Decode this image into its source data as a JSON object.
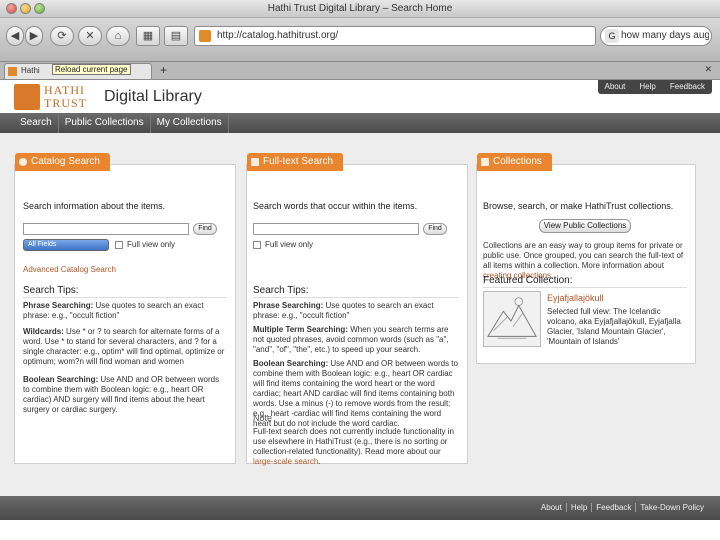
{
  "window": {
    "title": "Hathi Trust Digital Library – Search Home"
  },
  "toolbar": {
    "back": "◀",
    "forward": "▶",
    "reload": "⟳",
    "stop": "✕",
    "home": "⌂",
    "url": "http://catalog.hathitrust.org/",
    "search_value": "how many days august"
  },
  "tabs": {
    "tab_label": "Hathi Trust Digital Library – Search Home",
    "tab_prefix": "Hathi",
    "tooltip": "Reload current page",
    "new_tab": "+",
    "menu": "✕"
  },
  "site": {
    "logo_line1": "HATHI",
    "logo_line2": "TRUST",
    "brand": "Digital Library",
    "util": [
      "About",
      "Help",
      "Feedback"
    ],
    "nav": [
      "Search",
      "Public Collections",
      "My Collections"
    ]
  },
  "catalog": {
    "title": "Catalog Search",
    "intro": "Search information about the items.",
    "find": "Find",
    "field": "All Fields",
    "fullview": "Full view only",
    "advanced": "Advanced Catalog Search",
    "tips_title": "Search Tips:",
    "tips": [
      {
        "label": "Phrase Searching:",
        "text": " Use quotes to search an exact phrase: e.g., \"occult fiction\""
      },
      {
        "label": "Wildcards:",
        "text": " Use * or ? to search for alternate forms of a word. Use * to stand for several characters, and ? for a single character: e.g., optim* will find optimal, optimize or optimum; wom?n will find woman and women"
      },
      {
        "label": "Boolean Searching:",
        "text": " Use AND and OR between words to combine them with Boolean logic: e.g., heart OR cardiac) AND surgery will find items about the heart surgery or cardiac surgery."
      }
    ]
  },
  "fulltext": {
    "title": "Full-text Search",
    "intro": "Search words that occur within the items.",
    "find": "Find",
    "fullview": "Full view only",
    "tips_title": "Search Tips:",
    "tips": [
      {
        "label": "Phrase Searching:",
        "text": " Use quotes to search an exact phrase: e.g., \"occult fiction\""
      },
      {
        "label": "Multiple Term Searching:",
        "text": " When you search terms are not quoted phrases, avoid common words (such as \"a\", \"and\", \"of\", \"the\", etc.) to speed up your search."
      },
      {
        "label": "Boolean Searching:",
        "text": " Use AND and OR between words to combine them with Boolean logic: e.g., heart OR cardiac will find items containing the word heart or the word cardiac; heart AND cardiac will find items containing both words. Use a minus (-) to remove words from the result: e.g., heart -cardiac will find items containing the word heart but do not include the word cardiac."
      }
    ],
    "note_title": "Note",
    "note": "Full-text search does not currently include functionality in use elsewhere in HathiTrust (e.g., there is no sorting or collection-related functionality). Read more about our ",
    "note_link": "large-scale search",
    "note_end": "."
  },
  "collections": {
    "title": "Collections",
    "intro": "Browse, search, or make HathiTrust collections.",
    "button": "View Public Collections",
    "desc": "Collections are an easy way to group items for private or public use. Once grouped, you can search the full-text of all items within a collection. More information about ",
    "desc_link": "creating collections",
    "desc_end": ".",
    "featured_label": "Featured Collection:",
    "featured_name": "Eyjafjallajökull",
    "featured_desc": "Selected full view: The Icelandic volcano, aka Eyjafjallajökull, Eyjafjalla Glacier, 'Island Mountain Glacier', 'Mountain of Islands'"
  },
  "footer": {
    "links": [
      "About",
      "Help",
      "Feedback",
      "Take-Down Policy"
    ]
  },
  "colors": {
    "accent": "#e9852e",
    "nav": "#555555",
    "link": "#b2562b"
  }
}
